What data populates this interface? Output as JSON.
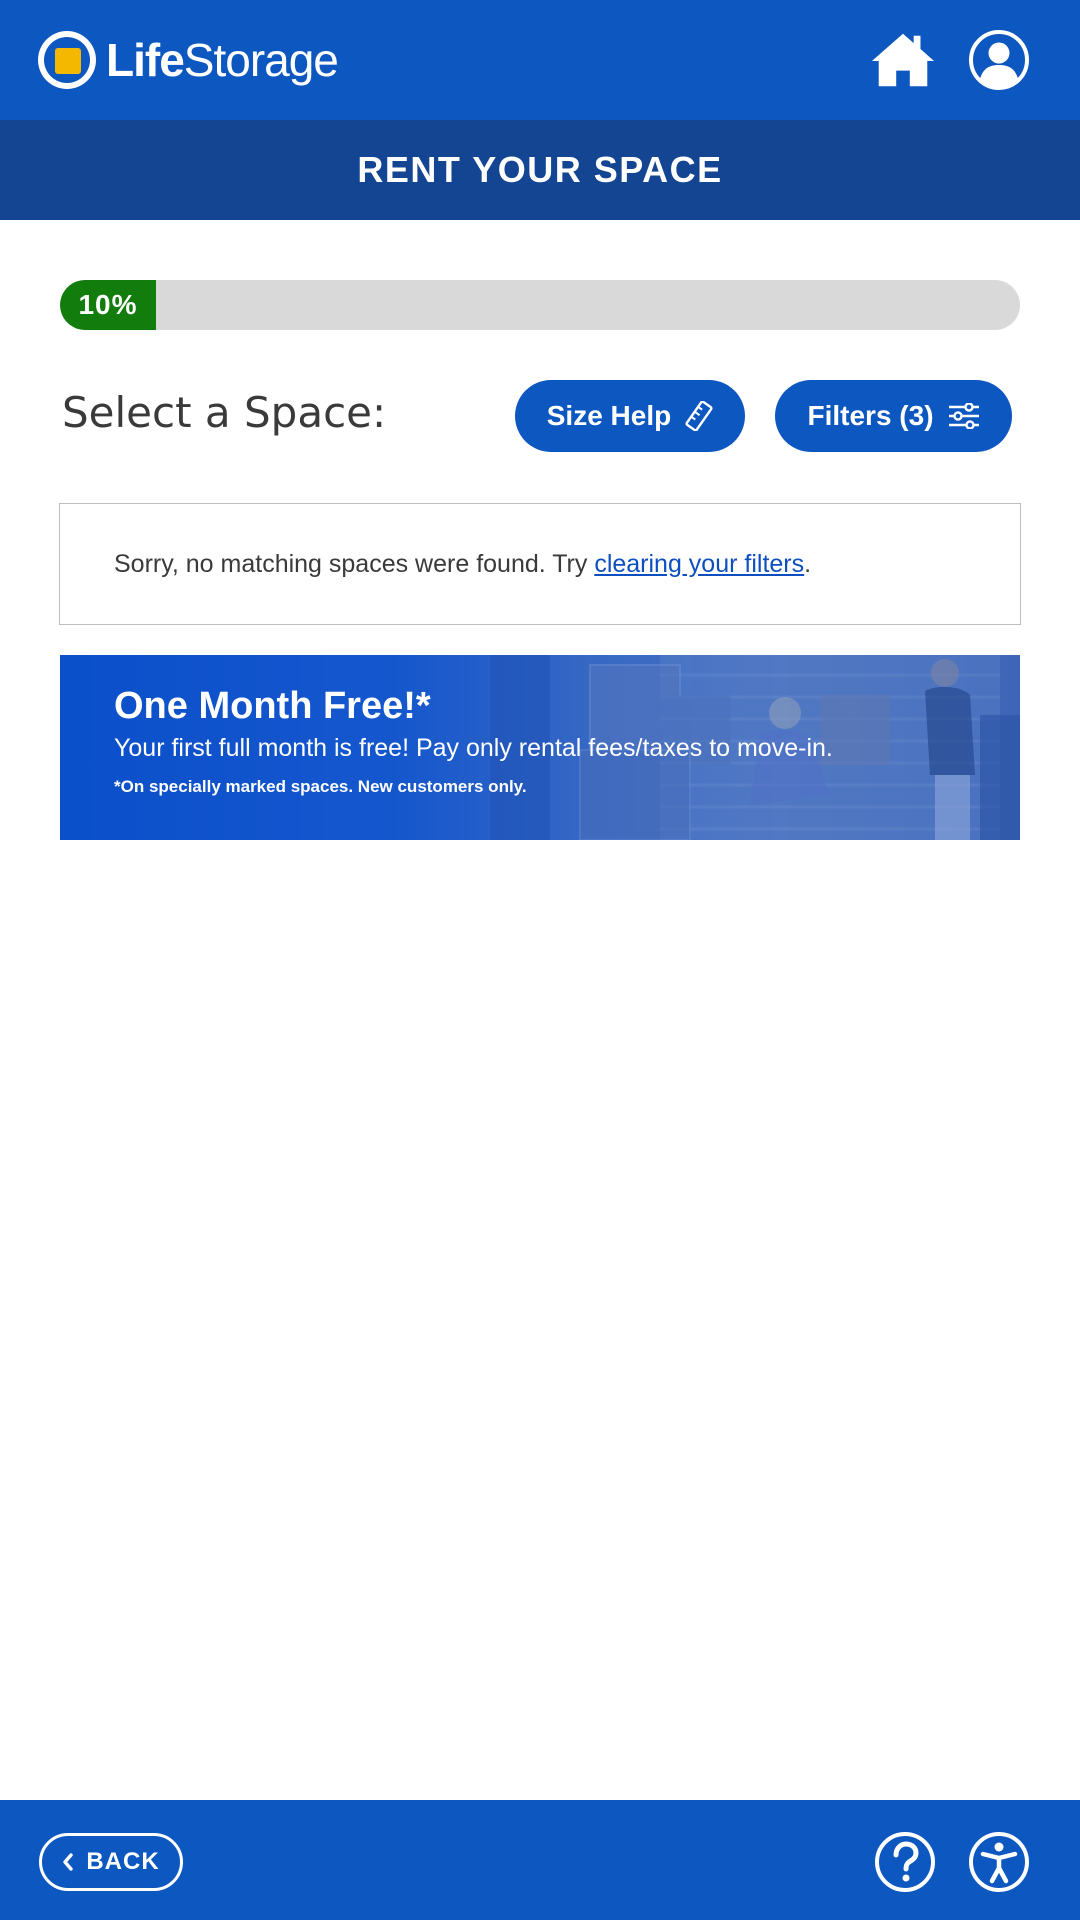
{
  "header": {
    "logo_bold": "Life",
    "logo_regular": "Storage",
    "home_icon": "home-icon",
    "account_icon": "user-icon"
  },
  "subheader": {
    "title": "RENT YOUR SPACE"
  },
  "progress": {
    "label": "10%",
    "value_percent": 10,
    "color": "#127c0d"
  },
  "select": {
    "title": "Select a Space:",
    "size_help_label": "Size Help",
    "size_help_icon": "ruler-icon",
    "filters_label": "Filters (3)",
    "filters_icon": "sliders-icon"
  },
  "notice": {
    "text_before": "Sorry, no matching spaces were found. Try ",
    "link_text": "clearing your filters",
    "text_after": "."
  },
  "promo": {
    "title": "One Month Free!*",
    "line1": "Your first full month is free! Pay only rental fees/taxes to move-in.",
    "line2": "*On specially marked spaces. New customers only."
  },
  "footer": {
    "back_label": "BACK",
    "help_icon": "help-icon",
    "accessibility_icon": "accessibility-icon"
  },
  "colors": {
    "brand_blue": "#0d57c0",
    "header_dark": "#144593",
    "progress_green": "#127c0d",
    "logo_yellow": "#f5b800"
  }
}
